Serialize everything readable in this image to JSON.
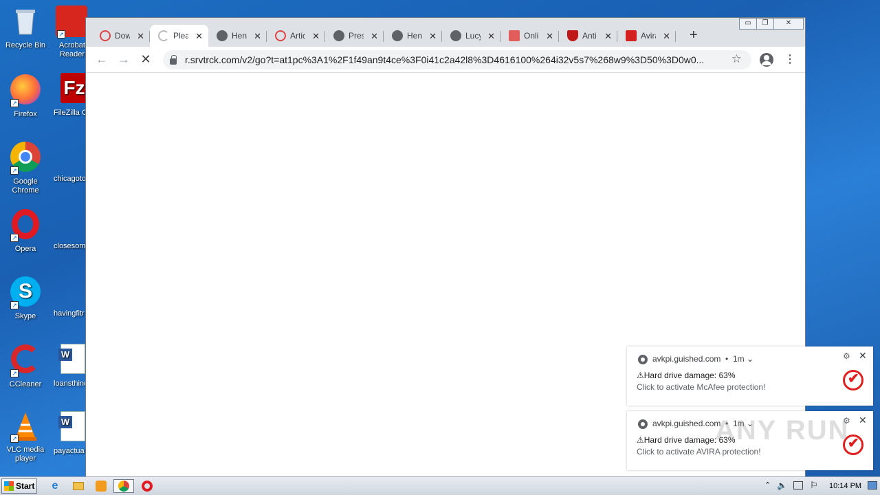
{
  "desktop": {
    "icons": [
      {
        "label": "Recycle Bin"
      },
      {
        "label": "Acrobat Reader"
      },
      {
        "label": "Firefox"
      },
      {
        "label": "FileZilla C"
      },
      {
        "label": "Google Chrome"
      },
      {
        "label": "chicagoto"
      },
      {
        "label": "Opera"
      },
      {
        "label": "closesome"
      },
      {
        "label": "Skype"
      },
      {
        "label": "havingfitr"
      },
      {
        "label": "CCleaner"
      },
      {
        "label": "loansthinc"
      },
      {
        "label": "VLC media player"
      },
      {
        "label": "payactua"
      }
    ]
  },
  "browser": {
    "tabs": [
      {
        "title": "Dow",
        "favicon": "flash-icon"
      },
      {
        "title": "Plea",
        "favicon": "loading-spinner-icon"
      },
      {
        "title": "Hen",
        "favicon": "globe-icon"
      },
      {
        "title": "Artic",
        "favicon": "flash-icon"
      },
      {
        "title": "Pres",
        "favicon": "globe-icon"
      },
      {
        "title": "Hen",
        "favicon": "globe-icon"
      },
      {
        "title": "Lucy",
        "favicon": "globe-icon"
      },
      {
        "title": "Onlir",
        "favicon": "red-square-icon"
      },
      {
        "title": "Anti",
        "favicon": "mcafee-shield-icon"
      },
      {
        "title": "Avira",
        "favicon": "avira-icon"
      }
    ],
    "new_tab_label": "+",
    "window_controls": {
      "minimize": "▭",
      "maximize": "❐",
      "close": "✕"
    },
    "url": "r.srvtrck.com/v2/go?t=at1pc%3A1%2F1f49an9t4ce%3F0i41c2a42l8%3D4616100%264i32v5s7%268w9%3D50%3D0w0..."
  },
  "notifications": [
    {
      "source": "avkpi.guished.com",
      "time": "1m",
      "title": "⚠Hard drive damage: 63%",
      "body": "Click to activate McAfee protection!"
    },
    {
      "source": "avkpi.guished.com",
      "time": "1m",
      "title": "⚠Hard drive damage: 63%",
      "body": "Click to activate AVIRA protection!"
    }
  ],
  "taskbar": {
    "start_label": "Start",
    "clock": "10:14 PM"
  },
  "watermark": "ANY RUN",
  "colors": {
    "accent_red": "#e02020",
    "desktop_blue": "#1c6fc4"
  }
}
